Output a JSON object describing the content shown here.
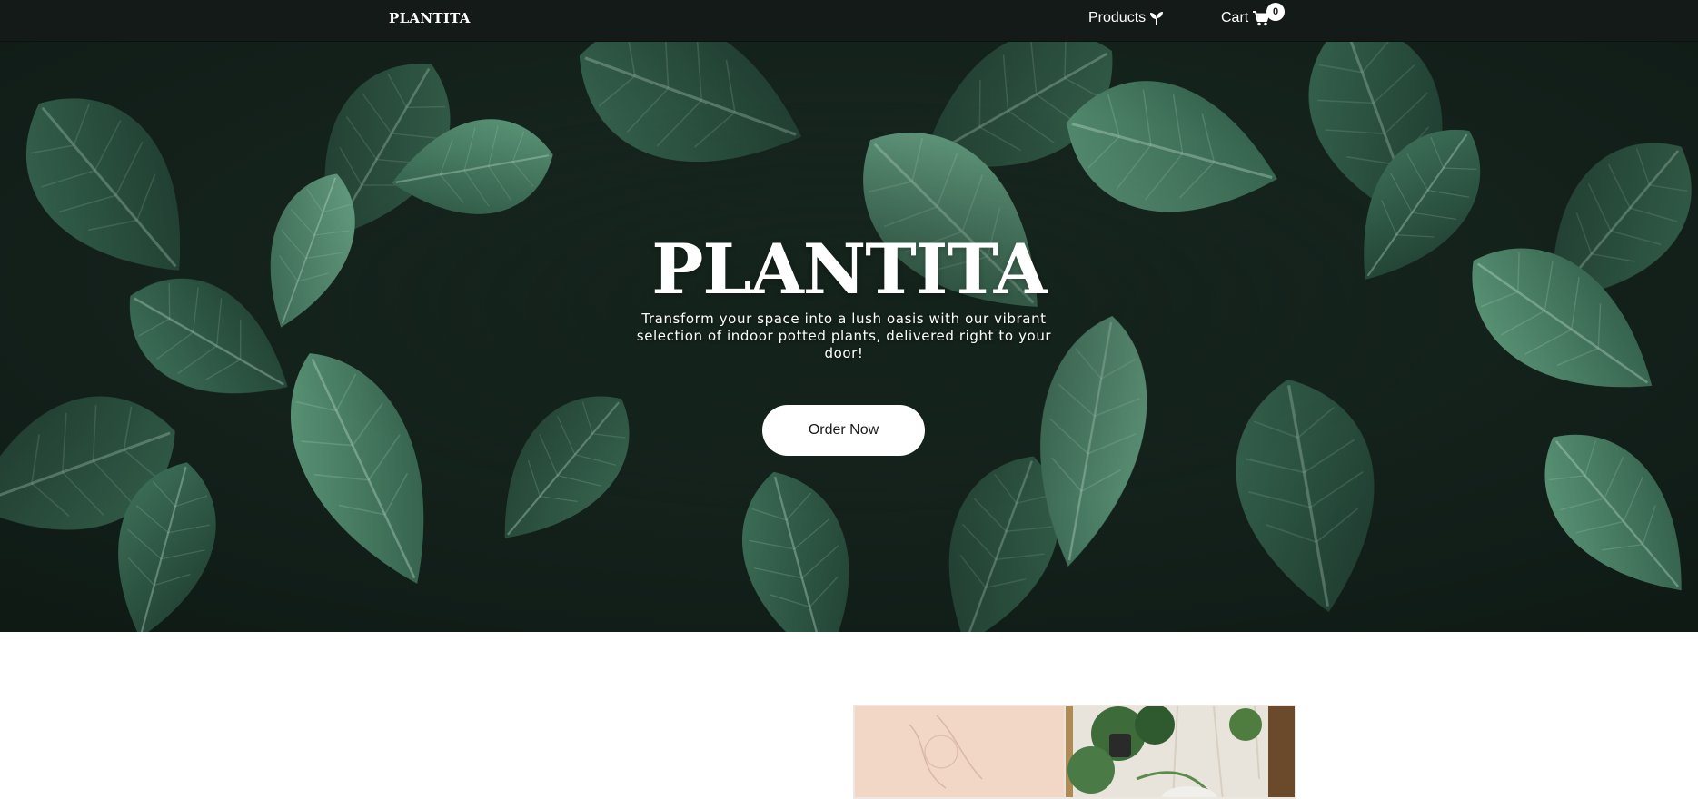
{
  "nav": {
    "brand": "PLANTITA",
    "products_label": "Products",
    "cart_label": "Cart",
    "cart_count": "0",
    "products_icon": "sprout-icon",
    "cart_icon": "shopping-cart-icon"
  },
  "hero": {
    "title": "PLANTITA",
    "subtitle": "Transform your space into a lush oasis with our vibrant selection of indoor potted plants, delivered right to your door!",
    "cta_label": "Order Now"
  },
  "colors": {
    "navbar_bg": "#131a17",
    "hero_leaf_dark": "#1d3328",
    "hero_leaf_light": "#4f8a6c",
    "button_bg": "#ffffff"
  }
}
